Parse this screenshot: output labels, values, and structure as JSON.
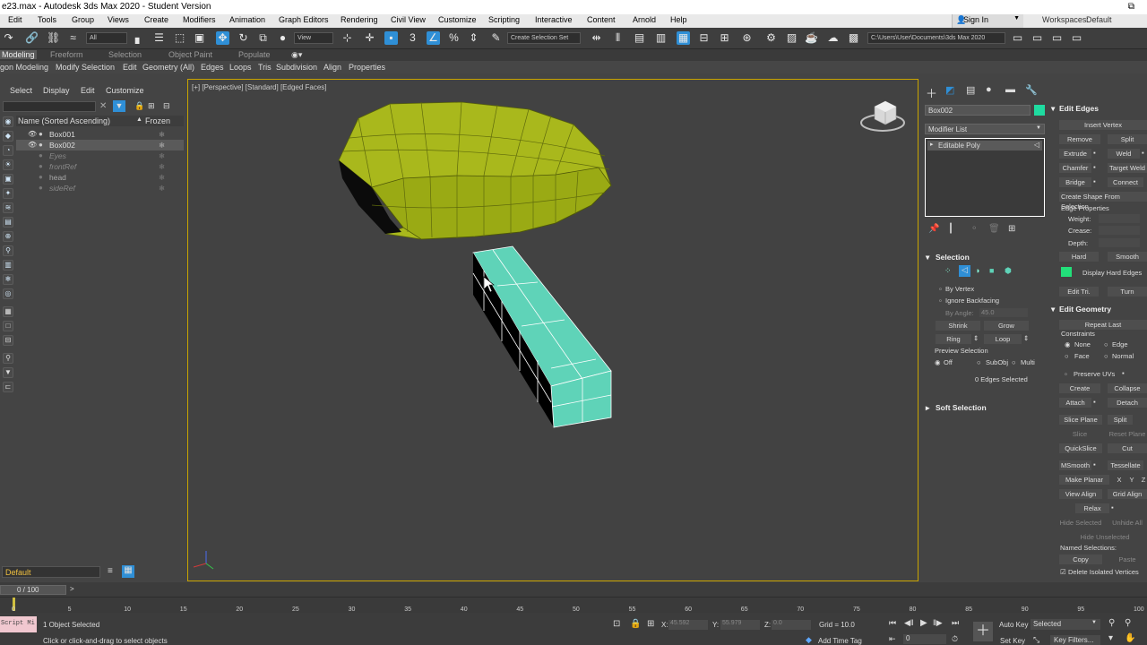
{
  "titlebar": {
    "title": "e23.max - Autodesk 3ds Max 2020 - Student Version",
    "restore_glyph": "⧉"
  },
  "menu": {
    "items": [
      "Edit",
      "Tools",
      "Group",
      "Views",
      "Create",
      "Modifiers",
      "Animation",
      "Graph Editors",
      "Rendering",
      "Civil View",
      "Customize",
      "Scripting",
      "Interactive",
      "Content",
      "Arnold",
      "Help"
    ],
    "sign_in": "Sign In",
    "workspaces_label": "Workspaces:",
    "workspaces_value": "Default"
  },
  "toolbar": {
    "selection_filter": "All",
    "ref_coord": "View",
    "named_selection": "Create Selection Set",
    "project_path": "C:\\Users\\User\\Documents\\3ds Max 2020"
  },
  "ribbon": {
    "tabs": [
      "Modeling",
      "Freeform",
      "Selection",
      "Object Paint",
      "Populate"
    ],
    "sub": [
      "gon Modeling",
      "Modify Selection",
      "Edit",
      "Geometry (All)",
      "Edges",
      "Loops",
      "Tris",
      "Subdivision",
      "Align",
      "Properties"
    ]
  },
  "scene_explorer": {
    "menu": [
      "Select",
      "Display",
      "Edit",
      "Customize"
    ],
    "col_name": "Name (Sorted Ascending)",
    "col_frozen": "Frozen",
    "rows": [
      {
        "name": "Box001",
        "visible": true,
        "selected": false,
        "dim": false
      },
      {
        "name": "Box002",
        "visible": true,
        "selected": true,
        "dim": false
      },
      {
        "name": "Eyes",
        "visible": false,
        "selected": false,
        "dim": true
      },
      {
        "name": "frontRef",
        "visible": false,
        "selected": false,
        "dim": true
      },
      {
        "name": "head",
        "visible": false,
        "selected": false,
        "dim": false
      },
      {
        "name": "sideRef",
        "visible": false,
        "selected": false,
        "dim": true
      }
    ],
    "layer": "Default"
  },
  "viewport": {
    "label": "[+] [Perspective] [Standard] [Edged Faces]",
    "colors": {
      "top_object": "#a9b81c",
      "bar_object": "#5fd3b8",
      "frame": "#c9a400"
    }
  },
  "command_panel": {
    "object_name": "Box002",
    "modifier_list": "Modifier List",
    "stack_item": "Editable Poly",
    "selection": {
      "title": "Selection",
      "by_vertex": "By Vertex",
      "ignore_backfacing": "Ignore Backfacing",
      "by_angle": "By Angle:",
      "angle_value": "45.0",
      "shrink": "Shrink",
      "grow": "Grow",
      "ring": "Ring",
      "loop": "Loop",
      "preview_label": "Preview Selection",
      "preview_options": [
        "Off",
        "SubObj",
        "Multi"
      ],
      "status": "0 Edges Selected"
    },
    "soft_selection": "Soft Selection"
  },
  "edit_edges": {
    "title": "Edit Edges",
    "insert_vertex": "Insert Vertex",
    "remove": "Remove",
    "split": "Split",
    "extrude": "Extrude",
    "weld": "Weld",
    "chamfer": "Chamfer",
    "target_weld": "Target Weld",
    "bridge": "Bridge",
    "connect": "Connect",
    "create_shape": "Create Shape From Selection",
    "edge_props": "Edge Properties",
    "weight": "Weight:",
    "crease": "Crease:",
    "depth": "Depth:",
    "hard": "Hard",
    "smooth": "Smooth",
    "display_hard": "Display Hard Edges",
    "edit_tri": "Edit Tri.",
    "turn": "Turn"
  },
  "edit_geometry": {
    "title": "Edit Geometry",
    "repeat_last": "Repeat Last",
    "constraints": "Constraints",
    "none": "None",
    "edge": "Edge",
    "face": "Face",
    "normal": "Normal",
    "preserve_uvs": "Preserve UVs",
    "create": "Create",
    "collapse": "Collapse",
    "attach": "Attach",
    "detach": "Detach",
    "slice_plane": "Slice Plane",
    "split": "Split",
    "slice": "Slice",
    "reset_plane": "Reset Plane",
    "quickslice": "QuickSlice",
    "cut": "Cut",
    "msmooth": "MSmooth",
    "tessellate": "Tessellate",
    "make_planar": "Make Planar",
    "x": "X",
    "y": "Y",
    "z": "Z",
    "view_align": "View Align",
    "grid_align": "Grid Align",
    "relax": "Relax",
    "hide_selected": "Hide Selected",
    "unhide_all": "Unhide All",
    "hide_unselected": "Hide Unselected",
    "named_selections": "Named Selections:",
    "copy": "Copy",
    "paste": "Paste",
    "delete_isolated": "Delete Isolated Vertices"
  },
  "timeline": {
    "frame_counter": "0 / 100",
    "ticks": [
      "0",
      "5",
      "10",
      "15",
      "20",
      "25",
      "30",
      "35",
      "40",
      "45",
      "50",
      "55",
      "60",
      "65",
      "70",
      "75",
      "80",
      "85",
      "90",
      "95",
      "100"
    ]
  },
  "status": {
    "maxscript": "Script Mi",
    "selected": "1 Object Selected",
    "prompt": "Click or click-and-drag to select objects",
    "x_label": "X:",
    "x_value": "45.592",
    "y_label": "Y:",
    "y_value": "55.979",
    "z_label": "Z:",
    "z_value": "0.0",
    "grid": "Grid = 10.0",
    "add_time_tag": "Add Time Tag",
    "frame": "0",
    "auto_key": "Auto Key",
    "set_key": "Set Key",
    "selected_dropdown": "Selected",
    "key_filters": "Key Filters..."
  }
}
